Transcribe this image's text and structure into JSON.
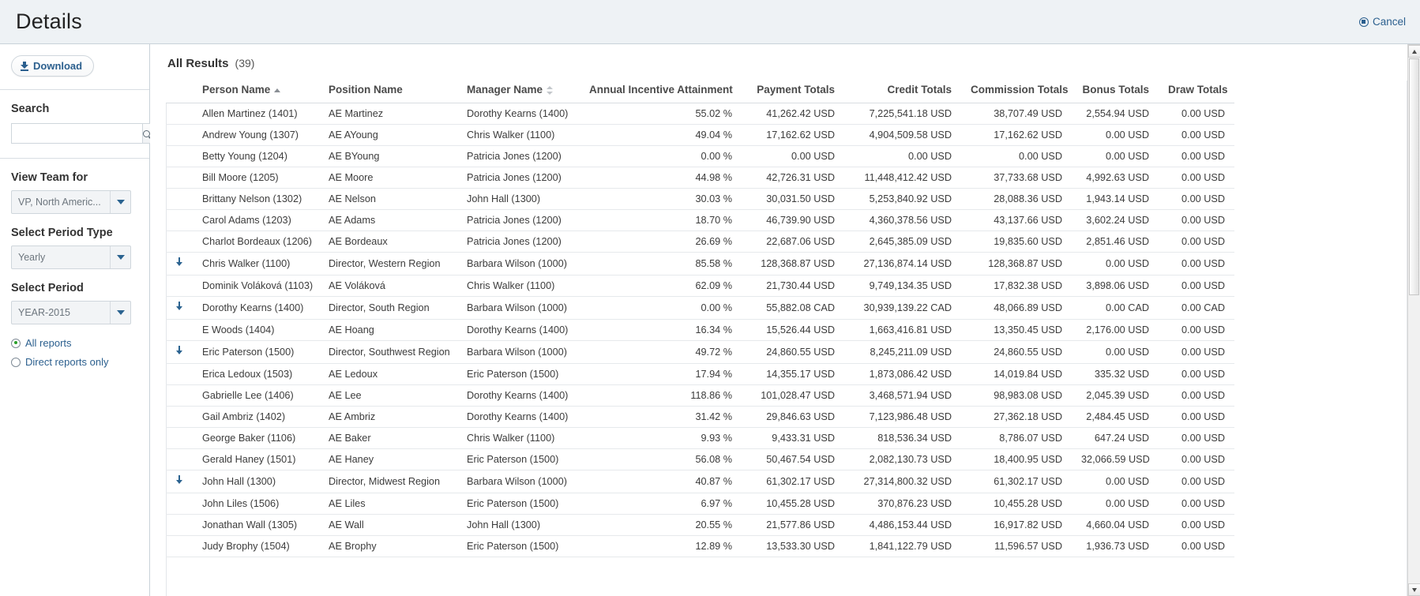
{
  "header": {
    "title": "Details",
    "cancel_label": "Cancel"
  },
  "sidebar": {
    "download_label": "Download",
    "search": {
      "label": "Search",
      "value": "",
      "placeholder": ""
    },
    "view_team": {
      "label": "View Team for",
      "value": "VP, North Americ..."
    },
    "period_type": {
      "label": "Select Period Type",
      "value": "Yearly"
    },
    "period": {
      "label": "Select Period",
      "value": "YEAR-2015"
    },
    "report_scope": {
      "options": [
        {
          "label": "All reports",
          "selected": true
        },
        {
          "label": "Direct reports only",
          "selected": false
        }
      ]
    }
  },
  "main": {
    "results_title": "All Results",
    "results_count": "(39)",
    "columns": [
      {
        "key": "drill",
        "label": "",
        "sort": "none",
        "align": "left"
      },
      {
        "key": "person",
        "label": "Person Name",
        "sort": "asc",
        "align": "left"
      },
      {
        "key": "position",
        "label": "Position Name",
        "sort": "none",
        "align": "left"
      },
      {
        "key": "manager",
        "label": "Manager Name",
        "sort": "both",
        "align": "left"
      },
      {
        "key": "attainment",
        "label": "Annual Incentive Attainment",
        "sort": "none",
        "align": "right"
      },
      {
        "key": "payment",
        "label": "Payment Totals",
        "sort": "none",
        "align": "right"
      },
      {
        "key": "credit",
        "label": "Credit Totals",
        "sort": "none",
        "align": "right"
      },
      {
        "key": "commission",
        "label": "Commission Totals",
        "sort": "none",
        "align": "right"
      },
      {
        "key": "bonus",
        "label": "Bonus Totals",
        "sort": "none",
        "align": "right"
      },
      {
        "key": "draw",
        "label": "Draw Totals",
        "sort": "none",
        "align": "right"
      }
    ],
    "rows": [
      {
        "drill": false,
        "person": "Allen Martinez (1401)",
        "position": "AE Martinez",
        "manager": "Dorothy Kearns (1400)",
        "attainment": "55.02 %",
        "payment": "41,262.42 USD",
        "credit": "7,225,541.18 USD",
        "commission": "38,707.49 USD",
        "bonus": "2,554.94 USD",
        "draw": "0.00 USD"
      },
      {
        "drill": false,
        "person": "Andrew Young (1307)",
        "position": "AE AYoung",
        "manager": "Chris Walker (1100)",
        "attainment": "49.04 %",
        "payment": "17,162.62 USD",
        "credit": "4,904,509.58 USD",
        "commission": "17,162.62 USD",
        "bonus": "0.00 USD",
        "draw": "0.00 USD"
      },
      {
        "drill": false,
        "person": "Betty Young (1204)",
        "position": "AE BYoung",
        "manager": "Patricia Jones (1200)",
        "attainment": "0.00 %",
        "payment": "0.00 USD",
        "credit": "0.00 USD",
        "commission": "0.00 USD",
        "bonus": "0.00 USD",
        "draw": "0.00 USD"
      },
      {
        "drill": false,
        "person": "Bill Moore (1205)",
        "position": "AE Moore",
        "manager": "Patricia Jones (1200)",
        "attainment": "44.98 %",
        "payment": "42,726.31 USD",
        "credit": "11,448,412.42 USD",
        "commission": "37,733.68 USD",
        "bonus": "4,992.63 USD",
        "draw": "0.00 USD"
      },
      {
        "drill": false,
        "person": "Brittany Nelson (1302)",
        "position": "AE Nelson",
        "manager": "John Hall (1300)",
        "attainment": "30.03 %",
        "payment": "30,031.50 USD",
        "credit": "5,253,840.92 USD",
        "commission": "28,088.36 USD",
        "bonus": "1,943.14 USD",
        "draw": "0.00 USD"
      },
      {
        "drill": false,
        "person": "Carol Adams (1203)",
        "position": "AE Adams",
        "manager": "Patricia Jones (1200)",
        "attainment": "18.70 %",
        "payment": "46,739.90 USD",
        "credit": "4,360,378.56 USD",
        "commission": "43,137.66 USD",
        "bonus": "3,602.24 USD",
        "draw": "0.00 USD"
      },
      {
        "drill": false,
        "person": "Charlot Bordeaux (1206)",
        "position": "AE Bordeaux",
        "manager": "Patricia Jones (1200)",
        "attainment": "26.69 %",
        "payment": "22,687.06 USD",
        "credit": "2,645,385.09 USD",
        "commission": "19,835.60 USD",
        "bonus": "2,851.46 USD",
        "draw": "0.00 USD"
      },
      {
        "drill": true,
        "person": "Chris Walker (1100)",
        "position": "Director, Western Region",
        "manager": "Barbara Wilson (1000)",
        "attainment": "85.58 %",
        "payment": "128,368.87 USD",
        "credit": "27,136,874.14 USD",
        "commission": "128,368.87 USD",
        "bonus": "0.00 USD",
        "draw": "0.00 USD"
      },
      {
        "drill": false,
        "person": "Dominik Voláková (1103)",
        "position": "AE Voláková",
        "manager": "Chris Walker (1100)",
        "attainment": "62.09 %",
        "payment": "21,730.44 USD",
        "credit": "9,749,134.35 USD",
        "commission": "17,832.38 USD",
        "bonus": "3,898.06 USD",
        "draw": "0.00 USD"
      },
      {
        "drill": true,
        "person": "Dorothy Kearns (1400)",
        "position": "Director, South Region",
        "manager": "Barbara Wilson (1000)",
        "attainment": "0.00 %",
        "payment": "55,882.08 CAD",
        "credit": "30,939,139.22 CAD",
        "commission": "48,066.89 USD",
        "bonus": "0.00 CAD",
        "draw": "0.00 CAD"
      },
      {
        "drill": false,
        "person": "E Woods (1404)",
        "position": "AE Hoang",
        "manager": "Dorothy Kearns (1400)",
        "attainment": "16.34 %",
        "payment": "15,526.44 USD",
        "credit": "1,663,416.81 USD",
        "commission": "13,350.45 USD",
        "bonus": "2,176.00 USD",
        "draw": "0.00 USD"
      },
      {
        "drill": true,
        "person": "Eric Paterson (1500)",
        "position": "Director, Southwest Region",
        "manager": "Barbara Wilson (1000)",
        "attainment": "49.72 %",
        "payment": "24,860.55 USD",
        "credit": "8,245,211.09 USD",
        "commission": "24,860.55 USD",
        "bonus": "0.00 USD",
        "draw": "0.00 USD"
      },
      {
        "drill": false,
        "person": "Erica Ledoux (1503)",
        "position": "AE Ledoux",
        "manager": "Eric Paterson (1500)",
        "attainment": "17.94 %",
        "payment": "14,355.17 USD",
        "credit": "1,873,086.42 USD",
        "commission": "14,019.84 USD",
        "bonus": "335.32 USD",
        "draw": "0.00 USD"
      },
      {
        "drill": false,
        "person": "Gabrielle Lee (1406)",
        "position": "AE Lee",
        "manager": "Dorothy Kearns (1400)",
        "attainment": "118.86 %",
        "payment": "101,028.47 USD",
        "credit": "3,468,571.94 USD",
        "commission": "98,983.08 USD",
        "bonus": "2,045.39 USD",
        "draw": "0.00 USD"
      },
      {
        "drill": false,
        "person": "Gail Ambriz (1402)",
        "position": "AE Ambriz",
        "manager": "Dorothy Kearns (1400)",
        "attainment": "31.42 %",
        "payment": "29,846.63 USD",
        "credit": "7,123,986.48 USD",
        "commission": "27,362.18 USD",
        "bonus": "2,484.45 USD",
        "draw": "0.00 USD"
      },
      {
        "drill": false,
        "person": "George Baker (1106)",
        "position": "AE Baker",
        "manager": "Chris Walker (1100)",
        "attainment": "9.93 %",
        "payment": "9,433.31 USD",
        "credit": "818,536.34 USD",
        "commission": "8,786.07 USD",
        "bonus": "647.24 USD",
        "draw": "0.00 USD"
      },
      {
        "drill": false,
        "person": "Gerald Haney (1501)",
        "position": "AE Haney",
        "manager": "Eric Paterson (1500)",
        "attainment": "56.08 %",
        "payment": "50,467.54 USD",
        "credit": "2,082,130.73 USD",
        "commission": "18,400.95 USD",
        "bonus": "32,066.59 USD",
        "draw": "0.00 USD"
      },
      {
        "drill": true,
        "person": "John Hall (1300)",
        "position": "Director, Midwest Region",
        "manager": "Barbara Wilson (1000)",
        "attainment": "40.87 %",
        "payment": "61,302.17 USD",
        "credit": "27,314,800.32 USD",
        "commission": "61,302.17 USD",
        "bonus": "0.00 USD",
        "draw": "0.00 USD"
      },
      {
        "drill": false,
        "person": "John Liles (1506)",
        "position": "AE Liles",
        "manager": "Eric Paterson (1500)",
        "attainment": "6.97 %",
        "payment": "10,455.28 USD",
        "credit": "370,876.23 USD",
        "commission": "10,455.28 USD",
        "bonus": "0.00 USD",
        "draw": "0.00 USD"
      },
      {
        "drill": false,
        "person": "Jonathan Wall (1305)",
        "position": "AE Wall",
        "manager": "John Hall (1300)",
        "attainment": "20.55 %",
        "payment": "21,577.86 USD",
        "credit": "4,486,153.44 USD",
        "commission": "16,917.82 USD",
        "bonus": "4,660.04 USD",
        "draw": "0.00 USD"
      },
      {
        "drill": false,
        "person": "Judy Brophy (1504)",
        "position": "AE Brophy",
        "manager": "Eric Paterson (1500)",
        "attainment": "12.89 %",
        "payment": "13,533.30 USD",
        "credit": "1,841,122.79 USD",
        "commission": "11,596.57 USD",
        "bonus": "1,936.73 USD",
        "draw": "0.00 USD"
      }
    ]
  },
  "colors": {
    "accent": "#2b5f8e",
    "header_bg": "#eef2f5",
    "radio_on": "#2aa02a",
    "caret": "#2b6390"
  }
}
